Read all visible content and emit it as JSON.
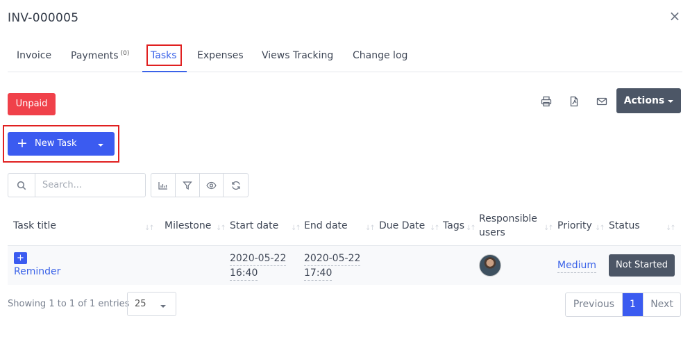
{
  "modal": {
    "title": "INV-000005",
    "close_glyph": "×"
  },
  "tabs": [
    {
      "label": "Invoice"
    },
    {
      "label": "Payments",
      "count": "(0)"
    },
    {
      "label": "Tasks",
      "active": true
    },
    {
      "label": "Expenses"
    },
    {
      "label": "Views Tracking"
    },
    {
      "label": "Change log"
    }
  ],
  "status_badge": {
    "label": "Unpaid",
    "color": "#f0414a"
  },
  "toolbar": {
    "icons": [
      "print-icon",
      "pdf-icon",
      "mail-icon"
    ],
    "actions_label": "Actions"
  },
  "new_task": {
    "label": "New Task",
    "color": "#3b5bf0"
  },
  "search": {
    "placeholder": "Search..."
  },
  "table_tools": [
    "chart-icon",
    "filter-icon",
    "eye-icon",
    "refresh-icon"
  ],
  "table": {
    "headers": [
      "Task title",
      "Milestone",
      "Start date",
      "End date",
      "Due Date",
      "Tags",
      "Responsible users",
      "Priority",
      "Status"
    ],
    "rows": [
      {
        "title": "Reminder",
        "milestone": "",
        "start_date": "2020-05-22",
        "start_time": "16:40",
        "end_date": "2020-05-22",
        "end_time": "17:40",
        "due_date": "",
        "tags": "",
        "priority": "Medium",
        "status": "Not Started"
      }
    ]
  },
  "pagination": {
    "info": "Showing 1 to 1 of 1 entries",
    "page_size": "25",
    "prev": "Previous",
    "current": "1",
    "next": "Next"
  },
  "colors": {
    "accent": "#3b5bf0",
    "danger": "#f0414a",
    "dark": "#4c5666",
    "highlight_box": "#e02020"
  }
}
